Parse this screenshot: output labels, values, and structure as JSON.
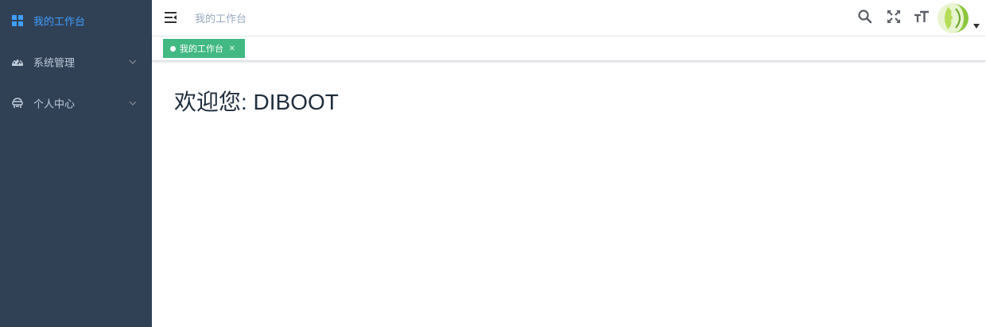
{
  "colors": {
    "sidebar_bg": "#304156",
    "sidebar_text": "#bfcbd9",
    "sidebar_active": "#409eff",
    "tag_active": "#42b983",
    "breadcrumb": "#97a8be"
  },
  "sidebar": {
    "items": [
      {
        "label": "我的工作台",
        "icon": "dashboard-grid-icon",
        "active": true,
        "has_children": false
      },
      {
        "label": "系统管理",
        "icon": "speedometer-icon",
        "active": false,
        "has_children": true
      },
      {
        "label": "个人中心",
        "icon": "user-icon",
        "active": false,
        "has_children": true
      }
    ]
  },
  "navbar": {
    "breadcrumb": "我的工作台",
    "icons": [
      "menu-fold-icon",
      "search-icon",
      "fullscreen-icon",
      "font-size-icon"
    ],
    "avatar": "avatar-icon"
  },
  "tags": [
    {
      "label": "我的工作台",
      "active": true,
      "closable": true,
      "close_label": "×"
    }
  ],
  "main": {
    "welcome": "欢迎您: DIBOOT"
  }
}
